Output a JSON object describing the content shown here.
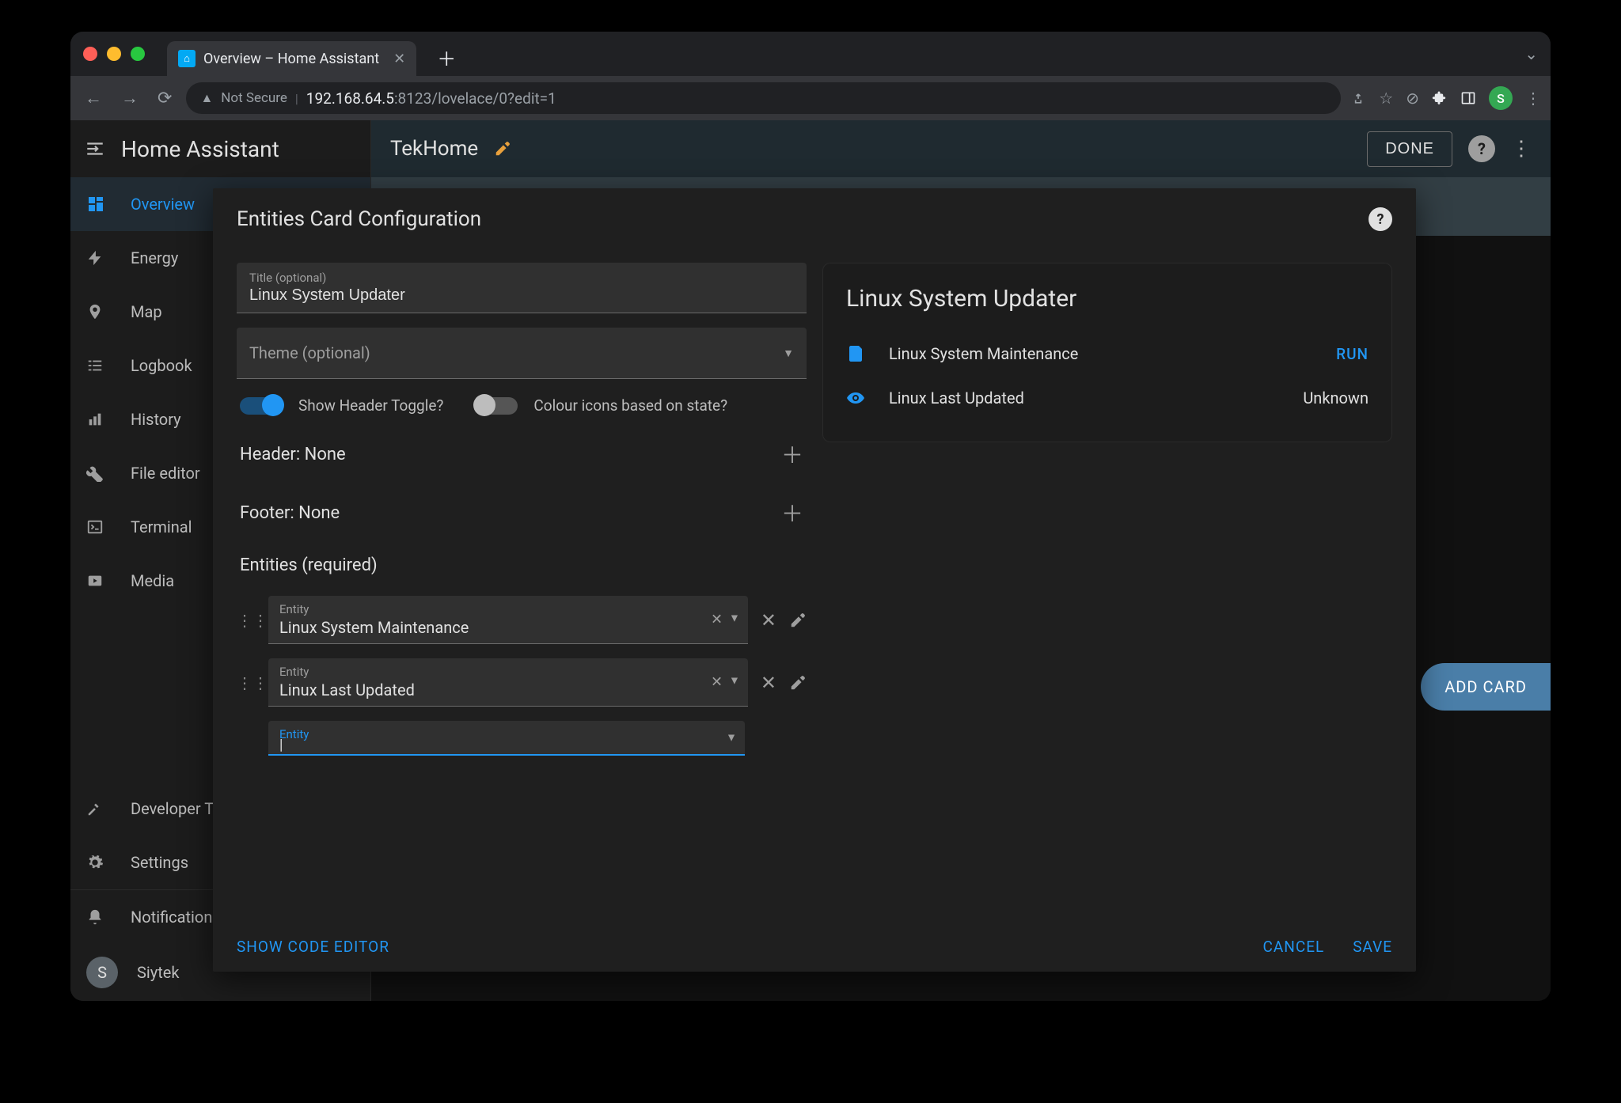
{
  "browser": {
    "tab_title": "Overview – Home Assistant",
    "secure_label": "Not Secure",
    "url_host": "192.168.64.5",
    "url_path": ":8123/lovelace/0?edit=1",
    "user_initial": "S"
  },
  "app": {
    "title": "Home Assistant",
    "dashboard_name": "TekHome",
    "done_label": "DONE",
    "add_card_label": "ADD CARD"
  },
  "sidebar": {
    "items": [
      {
        "label": "Overview"
      },
      {
        "label": "Energy"
      },
      {
        "label": "Map"
      },
      {
        "label": "Logbook"
      },
      {
        "label": "History"
      },
      {
        "label": "File editor"
      },
      {
        "label": "Terminal"
      },
      {
        "label": "Media"
      }
    ],
    "bottom": [
      {
        "label": "Developer Tools"
      },
      {
        "label": "Settings"
      },
      {
        "label": "Notifications"
      }
    ],
    "user": {
      "initial": "S",
      "name": "Siytek"
    }
  },
  "modal": {
    "title": "Entities Card Configuration",
    "title_field_label": "Title (optional)",
    "title_field_value": "Linux System Updater",
    "theme_field_label": "Theme (optional)",
    "toggle1_label": "Show Header Toggle?",
    "toggle2_label": "Colour icons based on state?",
    "header_label": "Header: None",
    "footer_label": "Footer: None",
    "entities_label": "Entities (required)",
    "entity_field_label": "Entity",
    "entities": [
      {
        "name": "Linux System Maintenance"
      },
      {
        "name": "Linux Last Updated"
      }
    ],
    "show_code_label": "SHOW CODE EDITOR",
    "cancel_label": "CANCEL",
    "save_label": "SAVE"
  },
  "preview": {
    "title": "Linux System Updater",
    "rows": [
      {
        "name": "Linux System Maintenance",
        "action": "RUN"
      },
      {
        "name": "Linux Last Updated",
        "value": "Unknown"
      }
    ]
  }
}
